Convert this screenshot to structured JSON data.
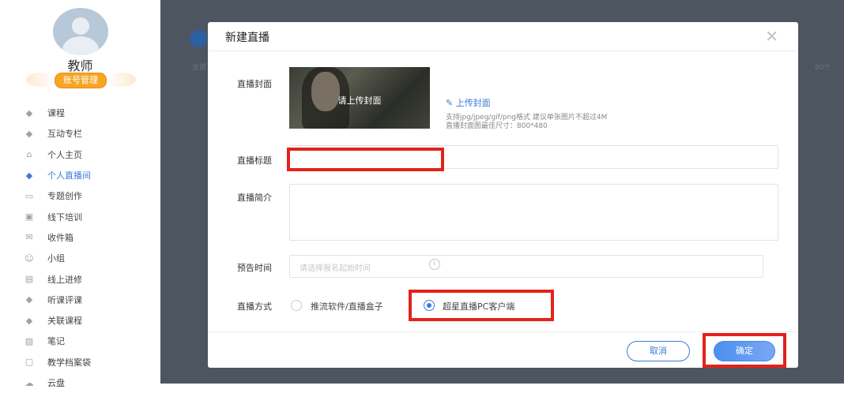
{
  "sidebar": {
    "name": "教师",
    "account_button": "账号管理",
    "items": [
      {
        "label": "课程",
        "icon": "cap-icon",
        "glyph": "◆"
      },
      {
        "label": "互动专栏",
        "icon": "cap-icon",
        "glyph": "◆"
      },
      {
        "label": "个人主页",
        "icon": "home-icon",
        "glyph": "⌂"
      },
      {
        "label": "个人直播间",
        "icon": "cap-icon",
        "glyph": "◆",
        "active": true
      },
      {
        "label": "专题创作",
        "icon": "window-icon",
        "glyph": "▭"
      },
      {
        "label": "线下培训",
        "icon": "board-icon",
        "glyph": "▣"
      },
      {
        "label": "收件箱",
        "icon": "inbox-icon",
        "glyph": "✉"
      },
      {
        "label": "小组",
        "icon": "group-icon",
        "glyph": "☺"
      },
      {
        "label": "线上进修",
        "icon": "study-icon",
        "glyph": "▤"
      },
      {
        "label": "听课评课",
        "icon": "cap-icon",
        "glyph": "◆"
      },
      {
        "label": "关联课程",
        "icon": "cap-icon",
        "glyph": "◆"
      },
      {
        "label": "笔记",
        "icon": "note-icon",
        "glyph": "▨"
      },
      {
        "label": "教学档案袋",
        "icon": "folder-icon",
        "glyph": "▢"
      },
      {
        "label": "云盘",
        "icon": "cloud-icon",
        "glyph": "☁"
      }
    ]
  },
  "background": {
    "left_text": "全部",
    "right_text": "80个"
  },
  "modal": {
    "title": "新建直播",
    "close": "✕",
    "cover_label": "直播封面",
    "cover_overlay": "请上传封面",
    "upload_link": "上传封面",
    "hint1": "支持jpg/jpeg/gif/png格式 建议单张图片不超过4M",
    "hint2": "直播封面图最佳尺寸：800*480",
    "title_label": "直播标题",
    "title_value": "",
    "intro_label": "直播简介",
    "intro_value": "",
    "time_label": "预告时间",
    "time_placeholder": "请选择报名起始时间",
    "mode_label": "直播方式",
    "mode_option1": "推流软件/直播盒子",
    "mode_option2": "超星直播PC客户端",
    "selected_mode": "超星直播PC客户端",
    "cancel": "取消",
    "confirm": "确定"
  },
  "colors": {
    "accent": "#3b7ad9",
    "highlight": "#e2231a",
    "badge": "#f5a623"
  }
}
